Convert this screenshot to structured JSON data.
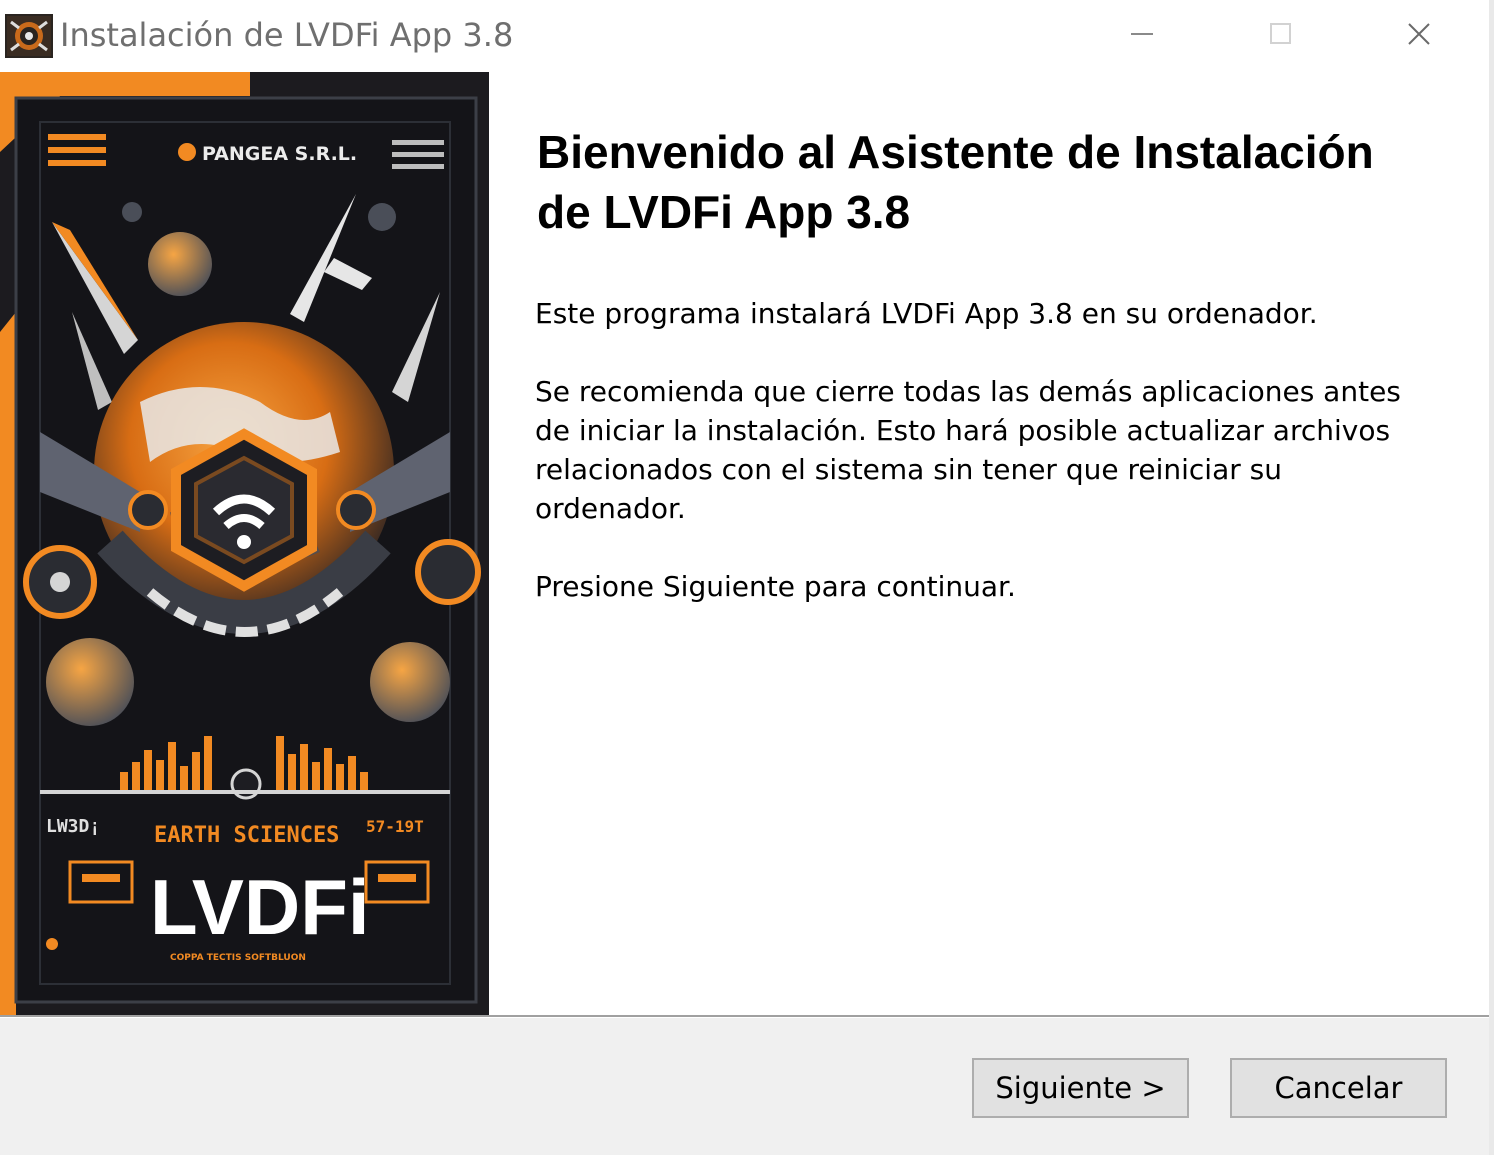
{
  "window": {
    "title": "Instalación de LVDFi App 3.8",
    "icon": "installer-app-icon",
    "controls": {
      "minimize": "minimize-icon",
      "maximize": "maximize-icon",
      "close": "close-icon"
    }
  },
  "side_image": {
    "company": "PANGEA S.R.L.",
    "brand": "LVDFi",
    "tagline": "EARTH SCIENCES",
    "left_tag": "LW3D¡",
    "right_tag": "57-19T",
    "footer_text": "COPPA TECTIS SOFTBLUON",
    "colors": {
      "orange": "#f28a22",
      "dark": "#141418",
      "grey": "#5f6370"
    }
  },
  "content": {
    "heading": "Bienvenido al Asistente de Instalación de LVDFi App 3.8",
    "paragraph1": "Este programa instalará LVDFi App 3.8 en su ordenador.",
    "paragraph2": "Se recomienda que cierre todas las demás aplicaciones antes de iniciar la instalación. Esto hará posible actualizar archivos relacionados con el sistema sin tener que reiniciar su ordenador.",
    "paragraph3": "Presione Siguiente para continuar."
  },
  "buttons": {
    "next": "Siguiente >",
    "cancel": "Cancelar"
  }
}
